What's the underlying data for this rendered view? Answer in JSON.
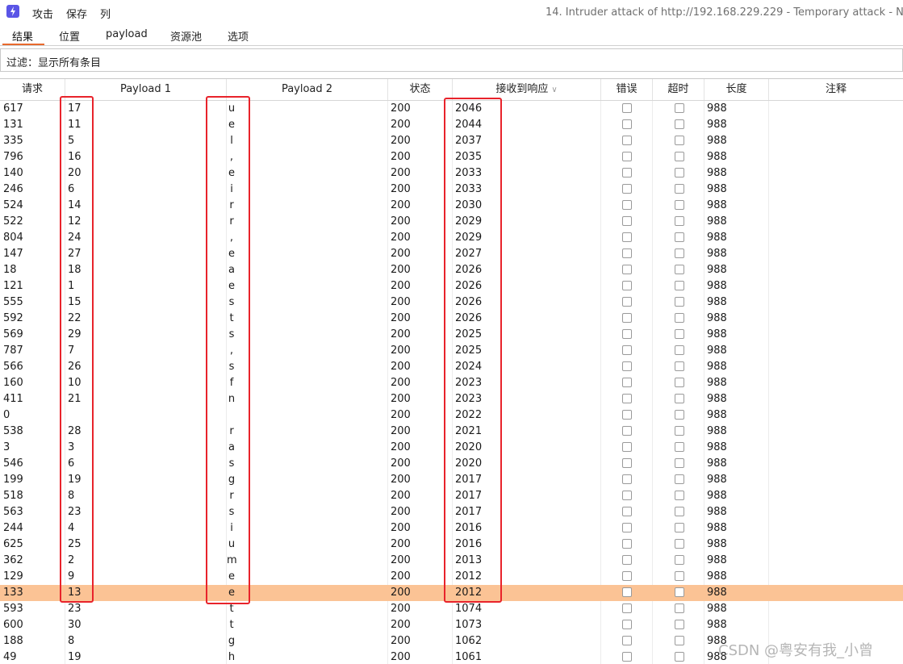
{
  "menubar": {
    "items": [
      "攻击",
      "保存",
      "列"
    ],
    "window_title": "14. Intruder attack of http://192.168.229.229 - Temporary attack - Not"
  },
  "tabs": [
    "结果",
    "位置",
    "payload",
    "资源池",
    "选项"
  ],
  "filter": {
    "text": "过滤：显示所有条目"
  },
  "table": {
    "columns": [
      "请求",
      "Payload 1",
      "Payload 2",
      "状态",
      "接收到响应",
      "错误",
      "超时",
      "长度",
      "注释"
    ],
    "rows": [
      {
        "req": "617",
        "p1": "17",
        "p2": "u",
        "status": "200",
        "resp": "2046",
        "len": "988"
      },
      {
        "req": "131",
        "p1": "11",
        "p2": "e",
        "status": "200",
        "resp": "2044",
        "len": "988"
      },
      {
        "req": "335",
        "p1": "5",
        "p2": "l",
        "status": "200",
        "resp": "2037",
        "len": "988"
      },
      {
        "req": "796",
        "p1": "16",
        "p2": ",",
        "status": "200",
        "resp": "2035",
        "len": "988"
      },
      {
        "req": "140",
        "p1": "20",
        "p2": "e",
        "status": "200",
        "resp": "2033",
        "len": "988"
      },
      {
        "req": "246",
        "p1": "6",
        "p2": "i",
        "status": "200",
        "resp": "2033",
        "len": "988"
      },
      {
        "req": "524",
        "p1": "14",
        "p2": "r",
        "status": "200",
        "resp": "2030",
        "len": "988"
      },
      {
        "req": "522",
        "p1": "12",
        "p2": "r",
        "status": "200",
        "resp": "2029",
        "len": "988"
      },
      {
        "req": "804",
        "p1": "24",
        "p2": ",",
        "status": "200",
        "resp": "2029",
        "len": "988"
      },
      {
        "req": "147",
        "p1": "27",
        "p2": "e",
        "status": "200",
        "resp": "2027",
        "len": "988"
      },
      {
        "req": "18",
        "p1": "18",
        "p2": "a",
        "status": "200",
        "resp": "2026",
        "len": "988"
      },
      {
        "req": "121",
        "p1": "1",
        "p2": "e",
        "status": "200",
        "resp": "2026",
        "len": "988"
      },
      {
        "req": "555",
        "p1": "15",
        "p2": "s",
        "status": "200",
        "resp": "2026",
        "len": "988"
      },
      {
        "req": "592",
        "p1": "22",
        "p2": "t",
        "status": "200",
        "resp": "2026",
        "len": "988"
      },
      {
        "req": "569",
        "p1": "29",
        "p2": "s",
        "status": "200",
        "resp": "2025",
        "len": "988"
      },
      {
        "req": "787",
        "p1": "7",
        "p2": ",",
        "status": "200",
        "resp": "2025",
        "len": "988"
      },
      {
        "req": "566",
        "p1": "26",
        "p2": "s",
        "status": "200",
        "resp": "2024",
        "len": "988"
      },
      {
        "req": "160",
        "p1": "10",
        "p2": "f",
        "status": "200",
        "resp": "2023",
        "len": "988"
      },
      {
        "req": "411",
        "p1": "21",
        "p2": "n",
        "status": "200",
        "resp": "2023",
        "len": "988"
      },
      {
        "req": "0",
        "p1": "",
        "p2": "",
        "status": "200",
        "resp": "2022",
        "len": "988"
      },
      {
        "req": "538",
        "p1": "28",
        "p2": "r",
        "status": "200",
        "resp": "2021",
        "len": "988"
      },
      {
        "req": "3",
        "p1": "3",
        "p2": "a",
        "status": "200",
        "resp": "2020",
        "len": "988"
      },
      {
        "req": "546",
        "p1": "6",
        "p2": "s",
        "status": "200",
        "resp": "2020",
        "len": "988"
      },
      {
        "req": "199",
        "p1": "19",
        "p2": "g",
        "status": "200",
        "resp": "2017",
        "len": "988"
      },
      {
        "req": "518",
        "p1": "8",
        "p2": "r",
        "status": "200",
        "resp": "2017",
        "len": "988"
      },
      {
        "req": "563",
        "p1": "23",
        "p2": "s",
        "status": "200",
        "resp": "2017",
        "len": "988"
      },
      {
        "req": "244",
        "p1": "4",
        "p2": "i",
        "status": "200",
        "resp": "2016",
        "len": "988"
      },
      {
        "req": "625",
        "p1": "25",
        "p2": "u",
        "status": "200",
        "resp": "2016",
        "len": "988"
      },
      {
        "req": "362",
        "p1": "2",
        "p2": "m",
        "status": "200",
        "resp": "2013",
        "len": "988"
      },
      {
        "req": "129",
        "p1": "9",
        "p2": "e",
        "status": "200",
        "resp": "2012",
        "len": "988"
      },
      {
        "req": "133",
        "p1": "13",
        "p2": "e",
        "status": "200",
        "resp": "2012",
        "len": "988",
        "highlight": true
      },
      {
        "req": "593",
        "p1": "23",
        "p2": "t",
        "status": "200",
        "resp": "1074",
        "len": "988"
      },
      {
        "req": "600",
        "p1": "30",
        "p2": "t",
        "status": "200",
        "resp": "1073",
        "len": "988"
      },
      {
        "req": "188",
        "p1": "8",
        "p2": "g",
        "status": "200",
        "resp": "1062",
        "len": "988"
      },
      {
        "req": "49",
        "p1": "19",
        "p2": "h",
        "status": "200",
        "resp": "1061",
        "len": "988"
      }
    ]
  },
  "watermark": "CSDN @粤安有我_小曾",
  "colors": {
    "highlight_row": "#fbc395",
    "annotation_red": "#e8232b",
    "tab_accent": "#e8692c"
  }
}
